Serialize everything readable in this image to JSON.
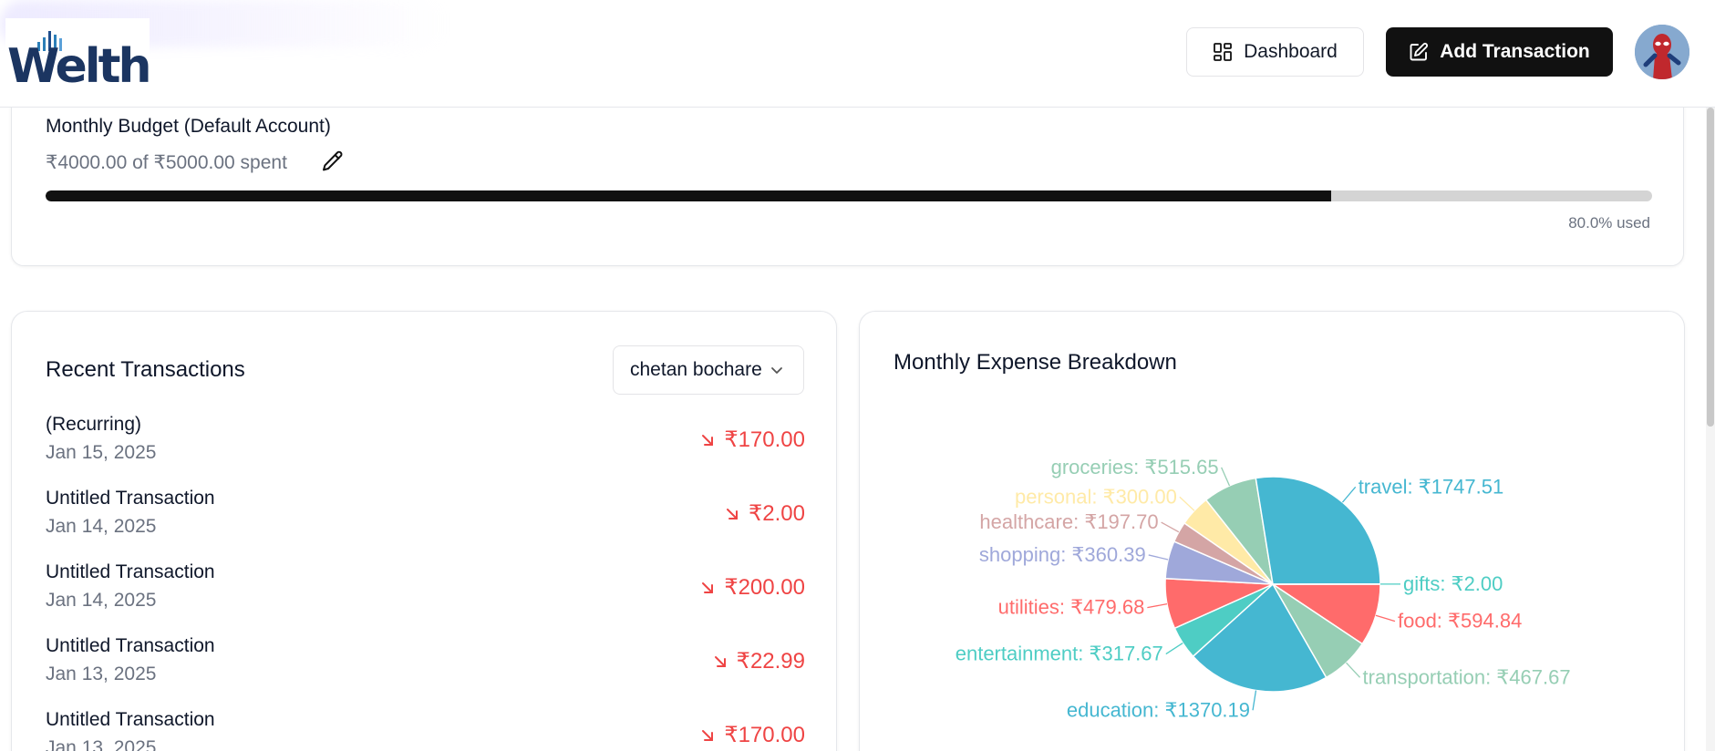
{
  "header": {
    "logo_text": "Welth",
    "dashboard_label": "Dashboard",
    "add_transaction_label": "Add Transaction"
  },
  "budget": {
    "title": "Monthly Budget (Default Account)",
    "spent_text": "₹4000.00 of ₹5000.00 spent",
    "progress_fraction": 0.8,
    "used_text": "80.0% used"
  },
  "transactions": {
    "title": "Recent Transactions",
    "account_selected": "chetan bochare",
    "items": [
      {
        "name": "(Recurring)",
        "date": "Jan 15, 2025",
        "amount": "₹170.00"
      },
      {
        "name": "Untitled Transaction",
        "date": "Jan 14, 2025",
        "amount": "₹2.00"
      },
      {
        "name": "Untitled Transaction",
        "date": "Jan 14, 2025",
        "amount": "₹200.00"
      },
      {
        "name": "Untitled Transaction",
        "date": "Jan 13, 2025",
        "amount": "₹22.99"
      },
      {
        "name": "Untitled Transaction",
        "date": "Jan 13, 2025",
        "amount": "₹170.00"
      }
    ]
  },
  "colors": {
    "expense": "#ef4444",
    "progress": "#111111",
    "track": "#d4d4d4"
  },
  "chart": {
    "title": "Monthly Expense Breakdown"
  },
  "chart_data": {
    "type": "pie",
    "title": "Monthly Expense Breakdown",
    "currency": "₹",
    "slices": [
      {
        "name": "food",
        "value": 594.84,
        "color": "#ff6b6b"
      },
      {
        "name": "transportation",
        "value": 467.67,
        "color": "#96ceb4"
      },
      {
        "name": "education",
        "value": 1370.19,
        "color": "#45b7d1"
      },
      {
        "name": "entertainment",
        "value": 317.67,
        "color": "#4ecdc4"
      },
      {
        "name": "utilities",
        "value": 479.68,
        "color": "#ff6b6b"
      },
      {
        "name": "shopping",
        "value": 360.39,
        "color": "#9fa8da"
      },
      {
        "name": "healthcare",
        "value": 197.7,
        "color": "#d4a5a5"
      },
      {
        "name": "personal",
        "value": 300.0,
        "color": "#ffeaa7"
      },
      {
        "name": "groceries",
        "value": 515.65,
        "color": "#96ceb4"
      },
      {
        "name": "travel",
        "value": 1747.51,
        "color": "#45b7d1"
      },
      {
        "name": "gifts",
        "value": 2.0,
        "color": "#4ecdc4"
      }
    ]
  }
}
